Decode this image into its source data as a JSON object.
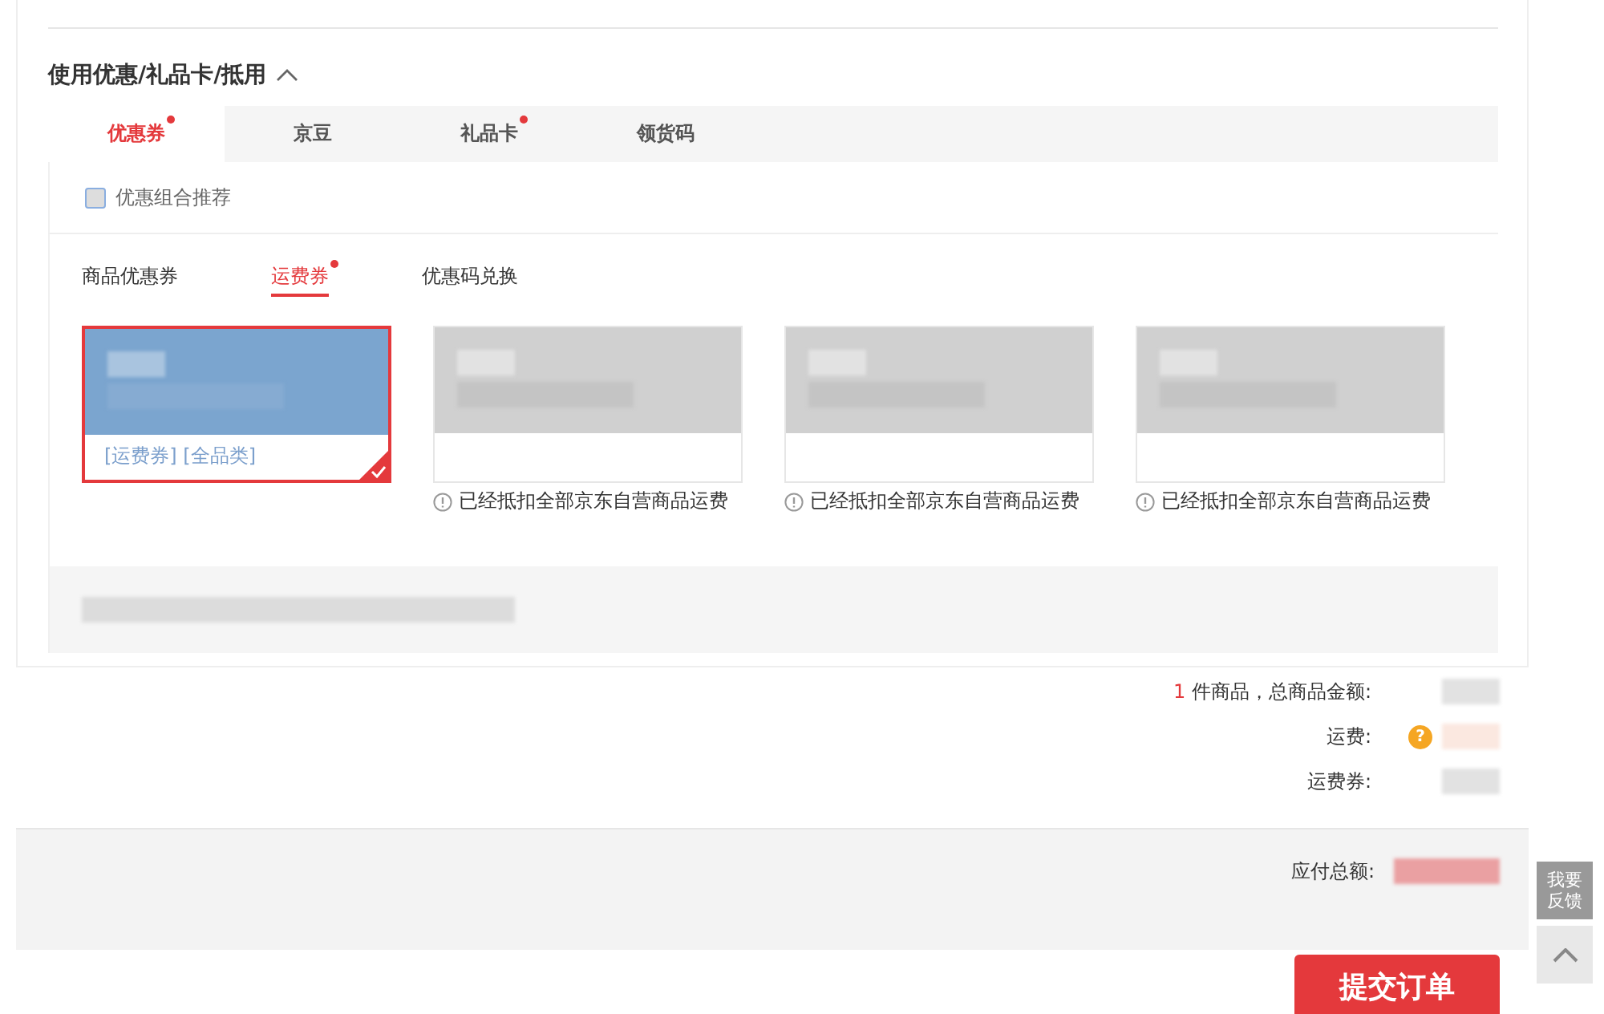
{
  "section": {
    "title": "使用优惠/礼品卡/抵用",
    "expanded": true
  },
  "tabs": [
    {
      "label": "优惠券",
      "selected": true,
      "dot": true
    },
    {
      "label": "京豆",
      "selected": false,
      "dot": false
    },
    {
      "label": "礼品卡",
      "selected": false,
      "dot": true
    },
    {
      "label": "领货码",
      "selected": false,
      "dot": false
    }
  ],
  "combo_checkbox": {
    "label": "优惠组合推荐",
    "checked": false
  },
  "subtabs": [
    {
      "label": "商品优惠券",
      "selected": false,
      "dot": false
    },
    {
      "label": "运费券",
      "selected": true,
      "dot": true
    },
    {
      "label": "优惠码兑换",
      "selected": false,
      "dot": false
    }
  ],
  "coupons": [
    {
      "selected": true,
      "kind": "usable",
      "tags": "[运费券] [全品类]"
    },
    {
      "selected": false,
      "kind": "disabled",
      "note": "已经抵扣全部京东自营商品运费"
    },
    {
      "selected": false,
      "kind": "disabled",
      "note": "已经抵扣全部京东自营商品运费"
    },
    {
      "selected": false,
      "kind": "disabled",
      "note": "已经抵扣全部京东自营商品运费"
    }
  ],
  "summary": [
    {
      "count": "1",
      "label": "件商品，总商品金额:",
      "help": false
    },
    {
      "label": "运费:",
      "help": true,
      "help_icon": "?"
    },
    {
      "label": "运费券:",
      "help": false
    }
  ],
  "footer": {
    "total_label": "应付总额:",
    "submit": "提交订单"
  },
  "side": {
    "feedback": "我要反馈"
  }
}
